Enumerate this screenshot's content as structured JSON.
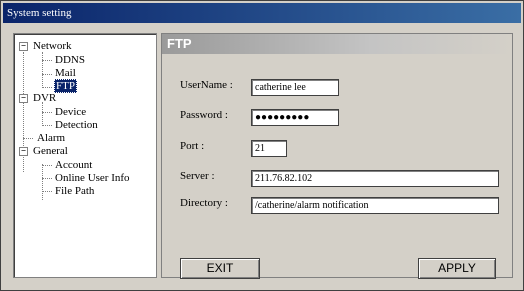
{
  "window": {
    "title": "System setting"
  },
  "tree": {
    "network": "Network",
    "ddns": "DDNS",
    "mail": "Mail",
    "ftp": "FTP",
    "dvr": "DVR",
    "device": "Device",
    "detection": "Detection",
    "alarm": "Alarm",
    "general": "General",
    "account": "Account",
    "online_user_info": "Online User Info",
    "file_path": "File Path"
  },
  "panel": {
    "title": "FTP",
    "username_label": "UserName :",
    "username_value": "catherine lee",
    "password_label": "Password :",
    "password_value": "●●●●●●●●●",
    "port_label": "Port :",
    "port_value": "21",
    "server_label": "Server :",
    "server_value": "211.76.82.102",
    "directory_label": "Directory :",
    "directory_value": "/catherine/alarm notification"
  },
  "buttons": {
    "exit": "EXIT",
    "apply": "APPLY"
  }
}
